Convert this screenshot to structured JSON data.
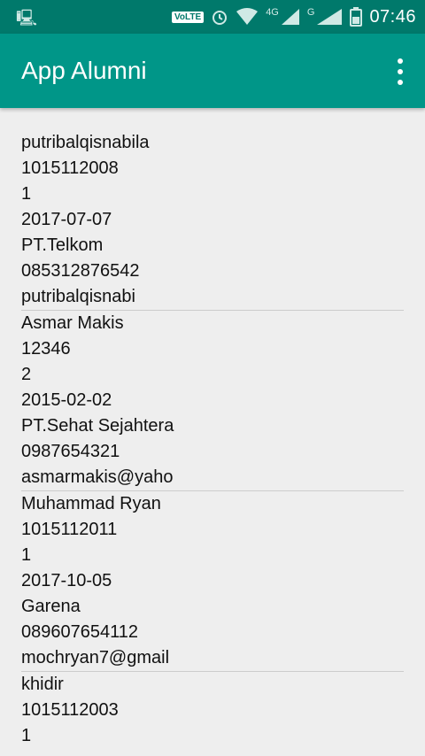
{
  "status_bar": {
    "volte": "VoLTE",
    "net1": "4G",
    "net2": "G",
    "time": "07:46"
  },
  "app_bar": {
    "title": "App Alumni"
  },
  "alumni": [
    {
      "name": "putribalqisnabila",
      "nim": "1015112008",
      "code": "1",
      "date": "2017-07-07",
      "company": "PT.Telkom",
      "phone": "085312876542",
      "email": "putribalqisnabi"
    },
    {
      "name": "Asmar Makis",
      "nim": "12346",
      "code": "2",
      "date": "2015-02-02",
      "company": "PT.Sehat Sejahtera",
      "phone": "0987654321",
      "email": "asmarmakis@yaho"
    },
    {
      "name": "Muhammad Ryan",
      "nim": "1015112011",
      "code": "1",
      "date": "2017-10-05",
      "company": "Garena",
      "phone": "089607654112",
      "email": "mochryan7@gmail"
    },
    {
      "name": "khidir",
      "nim": "1015112003",
      "code": "1"
    }
  ]
}
